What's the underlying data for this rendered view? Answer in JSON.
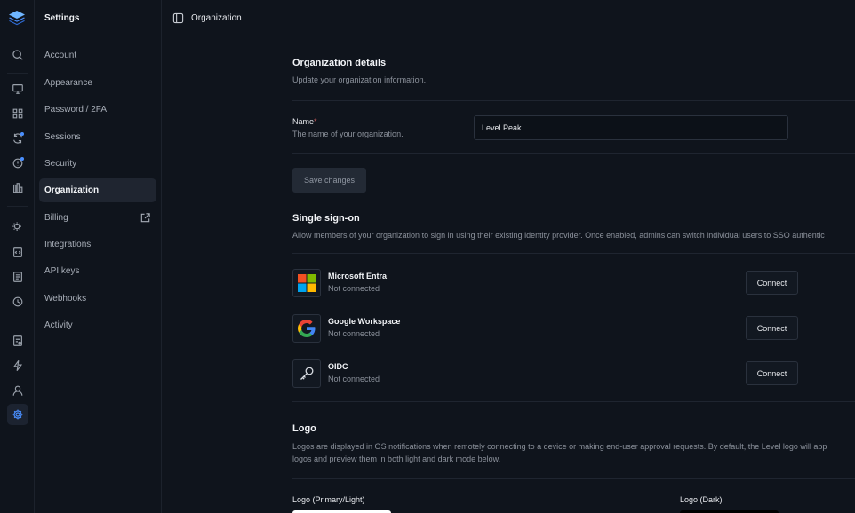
{
  "sidebar": {
    "title": "Settings",
    "items": [
      {
        "label": "Account"
      },
      {
        "label": "Appearance"
      },
      {
        "label": "Password / 2FA"
      },
      {
        "label": "Sessions"
      },
      {
        "label": "Security"
      },
      {
        "label": "Organization"
      },
      {
        "label": "Billing"
      },
      {
        "label": "Integrations"
      },
      {
        "label": "API keys"
      },
      {
        "label": "Webhooks"
      },
      {
        "label": "Activity"
      }
    ]
  },
  "topbar": {
    "breadcrumb": "Organization"
  },
  "org_details": {
    "heading": "Organization details",
    "description": "Update your organization information.",
    "name_label": "Name",
    "name_required": "*",
    "name_help": "The name of your organization.",
    "name_value": "Level Peak",
    "save_label": "Save changes"
  },
  "sso": {
    "heading": "Single sign-on",
    "description": "Allow members of your organization to sign in using their existing identity provider. Once enabled, admins can switch individual users to SSO authentic",
    "providers": [
      {
        "name": "Microsoft Entra",
        "status": "Not connected",
        "action": "Connect"
      },
      {
        "name": "Google Workspace",
        "status": "Not connected",
        "action": "Connect"
      },
      {
        "name": "OIDC",
        "status": "Not connected",
        "action": "Connect"
      }
    ]
  },
  "logo": {
    "heading": "Logo",
    "description_line1": "Logos are displayed in OS notifications when remotely connecting to a device or making end-user approval requests. By default, the Level logo will app",
    "description_line2": "logos and preview them in both light and dark mode below.",
    "primary_label": "Logo (Primary/Light)",
    "dark_label": "Logo (Dark)"
  },
  "colors": {
    "accent": "#4a8fff",
    "background": "#0f141c",
    "active_item": "#1f2530"
  }
}
